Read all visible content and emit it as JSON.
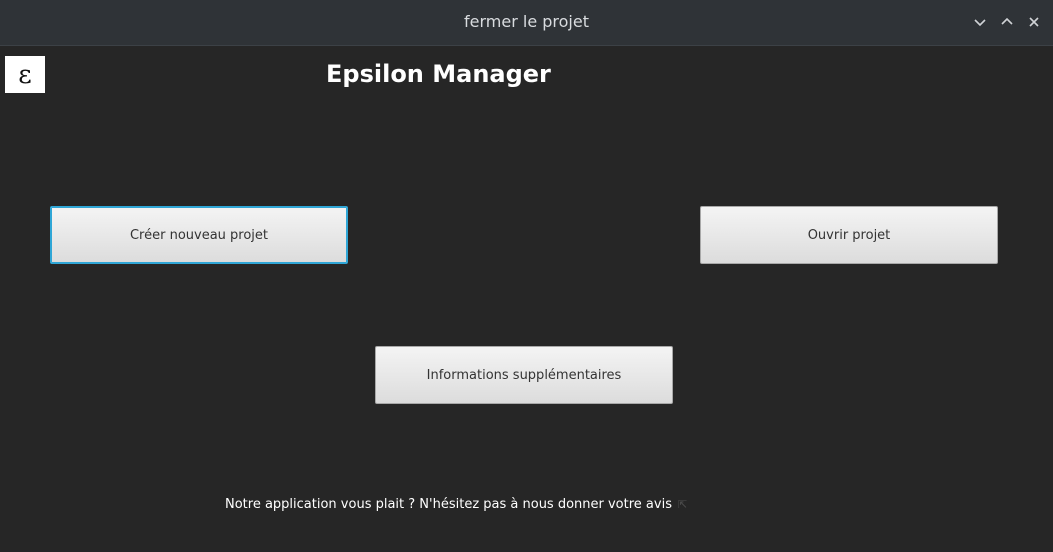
{
  "window": {
    "title": "fermer le projet",
    "controls": {
      "minimize": "chevron-down-icon",
      "maximize": "chevron-up-icon",
      "close": "close-icon"
    }
  },
  "app": {
    "logo": "ε",
    "title": "Epsilon Manager"
  },
  "buttons": {
    "create": "Créer nouveau projet",
    "open": "Ouvrir projet",
    "info": "Informations supplémentaires"
  },
  "footer": {
    "text": "Notre application vous plait ? N'hésitez pas à nous donner votre avis",
    "link_icon": "link-icon"
  },
  "colors": {
    "background": "#262626",
    "titlebar": "#2f3337",
    "focus": "#2fa6d6"
  }
}
